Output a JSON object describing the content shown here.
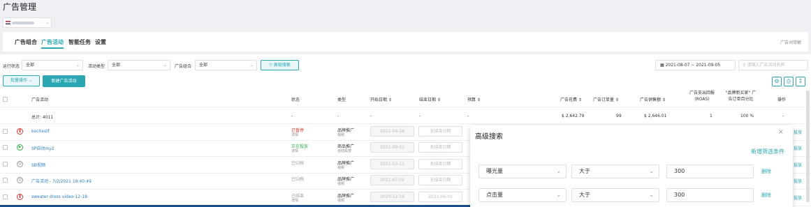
{
  "page": {
    "title": "广告管理"
  },
  "nav": {
    "tabs": [
      "广告组合",
      "广告活动",
      "智能任务",
      "设置"
    ],
    "active_tab": 1,
    "glossary": "广告词常解"
  },
  "filters": {
    "status_label": "运行状态",
    "status_value": "全部",
    "type_label": "活动类型",
    "type_value": "全部",
    "group_label": "广告组合",
    "group_value": "全部",
    "advanced_button": "高级搜索",
    "date_range": "2021-08-07 ~ 2021-09-05",
    "search_placeholder": "请输入广告活动名称"
  },
  "actions": {
    "batch": "批量操作",
    "new": "新建广告活动"
  },
  "table": {
    "headers": {
      "name": "广告活动",
      "status": "状态",
      "type": "类型",
      "start": "开始日期",
      "end": "结束日期",
      "budget": "预算",
      "spend": "广告花费",
      "orders": "广告订单量",
      "sales": "广告销售额",
      "roas_1": "广告支出回报",
      "roas_2": "(ROAS)",
      "newbuyer_1": "\"品牌新买家\" 广",
      "newbuyer_2": "告订单百分比",
      "action": "操作"
    },
    "totals": {
      "label": "总计: 4011",
      "status": "-",
      "type": "-",
      "start": "-",
      "end": "-",
      "budget": "-",
      "spend": "$ 2,642.79",
      "orders": "99",
      "sales": "$ 2,646.01",
      "roas": "1",
      "newbuyer": "100 %",
      "action": "-"
    },
    "end_placeholder": "无结束日期",
    "rows": [
      {
        "name": "kecitestf",
        "status": "已暂停",
        "status_sub": "详情",
        "status_color": "#e0312f",
        "icon_color": "#e0312f",
        "icon": "pause",
        "type": "品牌推广",
        "type_sub": "视频",
        "start": "2021-04-16",
        "end": "无结束日期",
        "action": "投放"
      },
      {
        "name": "SP自动my2",
        "status": "正在投放",
        "status_sub": "详情",
        "status_color": "#2cb044",
        "icon_color": "#2cb044",
        "icon": "play",
        "type": "商品推广",
        "type_sub": "自动投放",
        "start": "2021-09-02",
        "end": "无结束日期",
        "action": "投放"
      },
      {
        "name": "SB视频",
        "status": "已归档",
        "status_sub": "",
        "status_color": "#999999",
        "icon_color": "#999999",
        "icon": "archive",
        "type": "品牌推广",
        "type_sub": "视频",
        "start": "2021-03-11",
        "end": "无结束日期",
        "action": "投放"
      },
      {
        "name": "广告活动 - 7/2/2021 19:40:49",
        "status": "已归档",
        "status_sub": "",
        "status_color": "#999999",
        "icon_color": "#999999",
        "icon": "archive",
        "type": "品牌推广",
        "type_sub": "视频",
        "start": "2021-07-02",
        "end": "无结束日期",
        "action": "投放"
      },
      {
        "name": "sweater dress video-12-18",
        "status": "已结束",
        "status_sub": "详情",
        "status_color": "#999999",
        "icon_color": "#e0312f",
        "icon": "pause",
        "type": "品牌推广",
        "type_sub": "视频",
        "start": "2020-12-18",
        "end": "2021-06-01",
        "action": "投放"
      }
    ]
  },
  "advanced_panel": {
    "title": "高级搜索",
    "add_condition": "新增筛选条件",
    "conditions": [
      {
        "field": "曝光量",
        "operator": "大于",
        "value": "300",
        "delete": "删除"
      },
      {
        "field": "点击量",
        "operator": "大于",
        "value": "300",
        "delete": "删除"
      }
    ]
  }
}
